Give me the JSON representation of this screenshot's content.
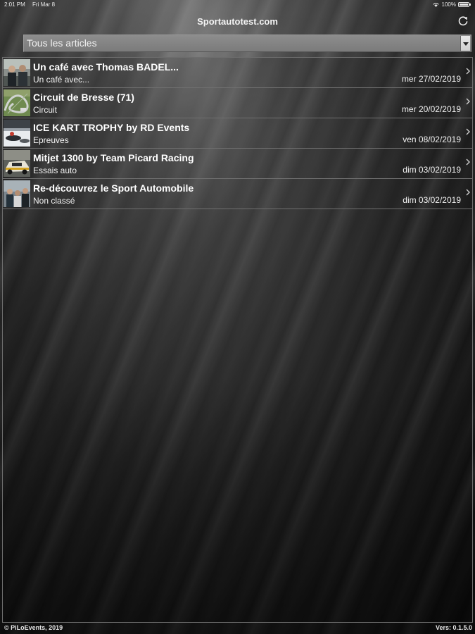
{
  "status_bar": {
    "time": "2:01 PM",
    "date": "Fri Mar 8",
    "battery": "100%"
  },
  "nav": {
    "title": "Sportautotest.com"
  },
  "filter": {
    "selected": "Tous les articles"
  },
  "articles": [
    {
      "title": "Un café avec Thomas BADEL...",
      "category": "Un café avec...",
      "date": "mer 27/02/2019",
      "thumbnail": "portrait-photo"
    },
    {
      "title": "Circuit de Bresse (71)",
      "category": "Circuit",
      "date": "mer 20/02/2019",
      "thumbnail": "circuit-aerial-photo"
    },
    {
      "title": "ICE KART TROPHY by RD Events",
      "category": "Epreuves",
      "date": "ven 08/02/2019",
      "thumbnail": "ice-kart-photo"
    },
    {
      "title": "Mitjet 1300 by Team Picard Racing",
      "category": "Essais auto",
      "date": "dim 03/02/2019",
      "thumbnail": "race-car-photo"
    },
    {
      "title": "Re-découvrez le Sport Automobile",
      "category": "Non classé",
      "date": "dim 03/02/2019",
      "thumbnail": "people-photo"
    }
  ],
  "footer": {
    "copyright": "© PiLoEvents, 2019",
    "version": "Vers: 0.1.5.0"
  }
}
